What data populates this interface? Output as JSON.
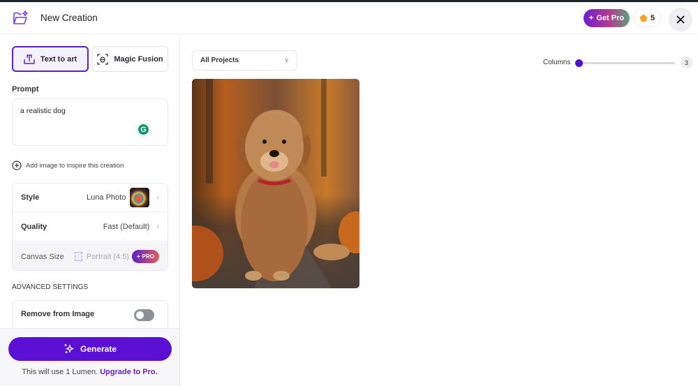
{
  "header": {
    "title": "New Creation",
    "get_pro_label": "Get Pro",
    "lumens_count": "5",
    "close_label": "Close"
  },
  "sidebar": {
    "tabs": [
      {
        "label": "Text to art",
        "icon": "text-art-icon",
        "active": true
      },
      {
        "label": "Magic Fusion",
        "icon": "magic-fusion-icon",
        "active": false
      }
    ],
    "prompt_label": "Prompt",
    "prompt_value": "a realistic dog",
    "add_image_label": "Add image to inspire this creation",
    "settings": {
      "style": {
        "label": "Style",
        "value": "Luna Photo"
      },
      "quality": {
        "label": "Quality",
        "value": "Fast (Default)"
      },
      "canvas": {
        "label": "Canvas Size",
        "value": "Portrait (4:5)",
        "badge": "PRO"
      }
    },
    "advanced_label": "ADVANCED SETTINGS",
    "remove_label": "Remove from Image",
    "remove_enabled": false,
    "generate_label": "Generate",
    "lumen_note": "This will use 1 Lumen.",
    "upgrade_link": "Upgrade to Pro."
  },
  "main": {
    "projects_select": "All Projects",
    "columns_label": "Columns",
    "columns_value": "3",
    "images": [
      {
        "alt": "Golden retriever sitting on an autumn forest path"
      }
    ]
  },
  "colors": {
    "accent": "#5a0fd3",
    "pro_gradient_start": "#5b1ec9",
    "pro_gradient_end": "#e0605d",
    "upgrade_link": "#6a1fb0"
  }
}
